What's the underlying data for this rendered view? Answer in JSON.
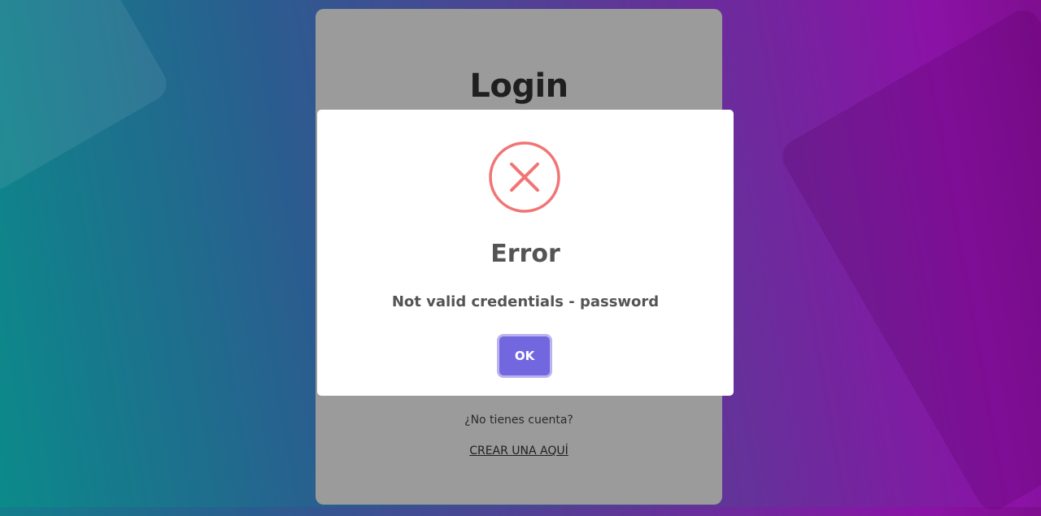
{
  "login": {
    "title": "Login",
    "no_account_text": "¿No tienes cuenta?",
    "create_link": "CREAR UNA AQUÍ"
  },
  "modal": {
    "icon": "error-x-icon",
    "title": "Error",
    "message": "Not valid credentials - password",
    "ok_label": "OK"
  },
  "colors": {
    "error": "#f27474",
    "button": "#7367e0",
    "card": "#9b9b9b",
    "text": "#545454"
  }
}
